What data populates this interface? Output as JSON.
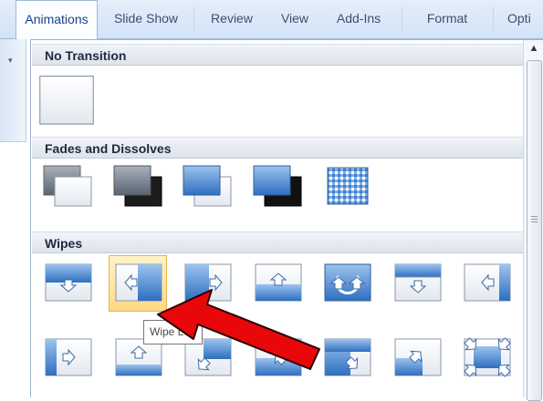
{
  "ribbon": {
    "tabs": [
      {
        "label": "Animations",
        "active": true
      },
      {
        "label": "Slide Show"
      },
      {
        "label": "Review"
      },
      {
        "label": "View"
      },
      {
        "label": "Add-Ins"
      },
      {
        "label": "Format"
      },
      {
        "label": "Opti"
      }
    ]
  },
  "gallery": {
    "sections": [
      {
        "title": "No Transition",
        "items": [
          "No Transition"
        ]
      },
      {
        "title": "Fades and Dissolves",
        "items": [
          "Fade Smoothly",
          "Fade Through Black",
          "Cut",
          "Cut Through Black",
          "Dissolve"
        ]
      },
      {
        "title": "Wipes",
        "items": [
          "Wipe Down",
          "Wipe Left",
          "Wipe Right",
          "Wipe Up",
          "Wedge",
          "Uncover Down",
          "Uncover Left",
          "Uncover Right",
          "Uncover Up",
          "Uncover Left-Down",
          "Uncover Left-Up",
          "Uncover Right-Down",
          "Uncover Right-Up",
          "Box In"
        ]
      }
    ],
    "selected_item": "Wipe Left"
  },
  "tooltip": {
    "text": "Wipe Left"
  },
  "annotation": {
    "arrow_color": "#e8080a",
    "highlight_color": "#ffd883"
  }
}
